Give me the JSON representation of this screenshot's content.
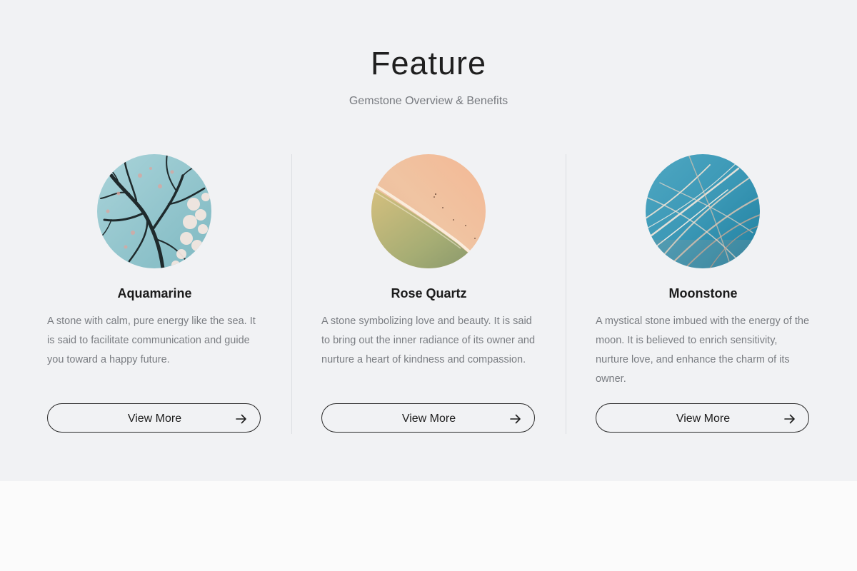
{
  "feature": {
    "title": "Feature",
    "subtitle": "Gemstone Overview & Benefits",
    "cards": [
      {
        "title": "Aquamarine",
        "description": "A stone with calm, pure energy like the sea. It is said to facilitate communication and guide you toward a happy future.",
        "button_label": "View More",
        "image_icon": "blossom-tree-photo"
      },
      {
        "title": "Rose Quartz",
        "description": "A stone symbolizing love and beauty. It is said to bring out the inner radiance of its owner and nurture a heart of kindness and compassion.",
        "button_label": "View More",
        "image_icon": "pink-beach-photo"
      },
      {
        "title": "Moonstone",
        "description": "A mystical stone imbued with the energy of the moon. It is believed to enrich sensitivity, nurture love, and enhance the charm of its owner.",
        "button_label": "View More",
        "image_icon": "grass-blue-sky-photo"
      }
    ],
    "button_icon": "arrow-right-icon"
  },
  "colors": {
    "section_background": "#f1f2f4",
    "page_background": "#fbfbfb",
    "title_text": "#1f1f1f",
    "muted_text": "#777a7f",
    "divider": "#dcdee2"
  }
}
